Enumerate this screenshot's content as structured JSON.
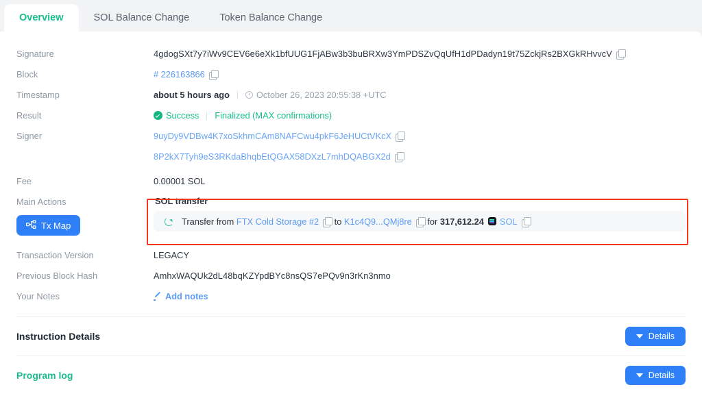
{
  "tabs": [
    {
      "label": "Overview",
      "active": true
    },
    {
      "label": "SOL Balance Change",
      "active": false
    },
    {
      "label": "Token Balance Change",
      "active": false
    }
  ],
  "details": {
    "signature": {
      "label": "Signature",
      "value": "4gdogSXt7y7iWv9CEV6e6eXk1bfUUG1FjABw3b3buBRXw3YmPDSZvQqUfH1dPDadyn19t75ZckjRs2BXGkRHvvcV"
    },
    "block": {
      "label": "Block",
      "value": "# 226163866"
    },
    "timestamp": {
      "label": "Timestamp",
      "relative": "about 5 hours ago",
      "absolute": "October 26, 2023 20:55:38 +UTC"
    },
    "result": {
      "label": "Result",
      "status": "Success",
      "confirmation": "Finalized (MAX confirmations)"
    },
    "signer": {
      "label": "Signer",
      "addresses": [
        "9uyDy9VDBw4K7xoSkhmCAm8NAFCwu4pkF6JeHUCtVKcX",
        "8P2kX7Tyh9eS3RKdaBhqbEtQGAX58DXzL7mhDQABGX2d"
      ]
    },
    "fee": {
      "label": "Fee",
      "value": "0.00001 SOL"
    },
    "main_actions": {
      "label": "Main Actions",
      "tx_map_button": "Tx Map",
      "title": "SOL transfer",
      "transfer": {
        "prefix": "Transfer from",
        "from": "FTX Cold Storage #2",
        "to_word": "to",
        "to": "K1c4Q9...QMj8re",
        "for_word": "for",
        "amount": "317,612.24",
        "token": "SOL"
      }
    },
    "transaction_version": {
      "label": "Transaction Version",
      "value": "LEGACY"
    },
    "previous_block_hash": {
      "label": "Previous Block Hash",
      "value": "AmhxWAQUk2dL48bqKZYpdBYc8nsQS7ePQv9n3rKn3nmo"
    },
    "your_notes": {
      "label": "Your Notes",
      "action": "Add notes"
    }
  },
  "sections": [
    {
      "title": "Instruction Details",
      "button": "Details",
      "green": false
    },
    {
      "title": "Program log",
      "button": "Details",
      "green": true
    }
  ],
  "colors": {
    "accent_green": "#18bd8d",
    "link_blue": "#5b9bf3",
    "button_blue": "#2f80f7",
    "highlight_red": "#f4381f"
  }
}
